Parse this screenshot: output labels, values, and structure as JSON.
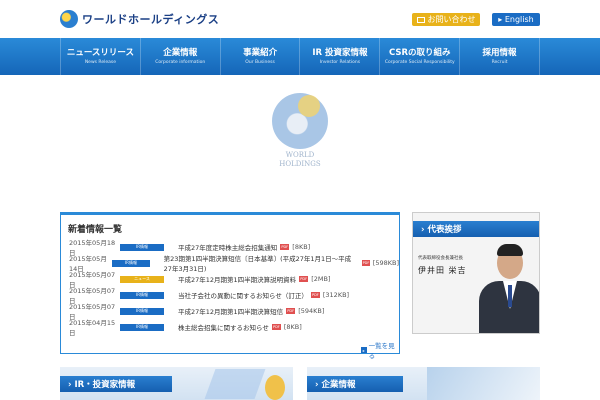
{
  "header": {
    "logo_text": "ワールドホールディングス",
    "contact_label": "お問い合わせ",
    "english_label": "▸ English"
  },
  "nav": [
    {
      "jp": "ニュースリリース",
      "en": "News Release"
    },
    {
      "jp": "企業情報",
      "en": "Corporate information"
    },
    {
      "jp": "事業紹介",
      "en": "Our Business"
    },
    {
      "jp": "IR 投資家情報",
      "en": "Investor Relations"
    },
    {
      "jp": "CSRの取り組み",
      "en": "Corporate Social Responsibility"
    },
    {
      "jp": "採用情報",
      "en": "Recruit"
    }
  ],
  "hero": {
    "line1": "WORLD",
    "line2": "HOLDINGS"
  },
  "news": {
    "heading": "新着情報一覧",
    "more_label": "一覧を見る",
    "items": [
      {
        "date": "2015年05月18日",
        "tag": "IR情報",
        "tag_alt": false,
        "title": "平成27年度定時株主総会招集通知",
        "has_pdf": true,
        "size": "[8KB]"
      },
      {
        "date": "2015年05月14日",
        "tag": "IR情報",
        "tag_alt": false,
        "title": "第23期第1四半期決算短信〔日本基準〕(平成27年1月1日～平成27年3月31日)",
        "has_pdf": true,
        "size": "[598KB]"
      },
      {
        "date": "2015年05月07日",
        "tag": "ニュース",
        "tag_alt": true,
        "title": "平成27年12月期第1四半期決算説明資料",
        "has_pdf": true,
        "size": "[2MB]"
      },
      {
        "date": "2015年05月07日",
        "tag": "IR情報",
        "tag_alt": false,
        "title": "当社子会社の異動に関するお知らせ（訂正）",
        "has_pdf": true,
        "size": "[312KB]"
      },
      {
        "date": "2015年05月07日",
        "tag": "IR情報",
        "tag_alt": false,
        "title": "平成27年12月期第1四半期決算短信",
        "has_pdf": true,
        "size": "[594KB]"
      },
      {
        "date": "2015年04月15日",
        "tag": "IR情報",
        "tag_alt": false,
        "title": "株主総会招集に関するお知らせ",
        "has_pdf": true,
        "size": "[8KB]"
      }
    ]
  },
  "message": {
    "heading": "› 代表挨拶",
    "role": "代表取締役会長兼社長",
    "name": "伊井田 栄吉"
  },
  "banners": {
    "ir_label": "› IR・投資家情報",
    "corp_label": "› 企業情報"
  },
  "colors": {
    "brand_blue": "#1a6cc4",
    "accent_yellow": "#e8b21a"
  }
}
